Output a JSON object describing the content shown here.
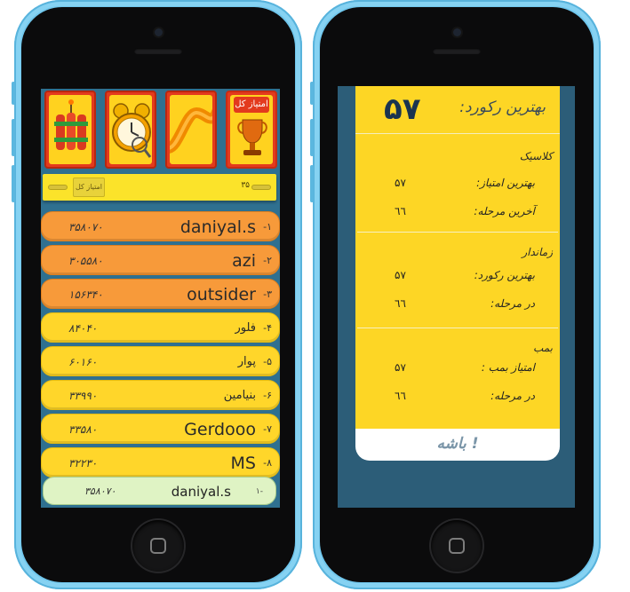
{
  "left": {
    "tiles": {
      "total_score_tile_label": "امتیاز کل"
    },
    "score_bar": {
      "label": "امتیاز کل",
      "value": "۳۵"
    },
    "leaderboard": [
      {
        "rank": "-۱",
        "name": "daniyal.s",
        "points": "۳۵۸۰۷۰",
        "highlight": true
      },
      {
        "rank": "-۲",
        "name": "azi",
        "points": "۳۰۵۵۸۰",
        "highlight": true
      },
      {
        "rank": "-۳",
        "name": "outsider",
        "points": "۱۵۶۳۴۰",
        "highlight": true
      },
      {
        "rank": "-۴",
        "name": "فلور",
        "points": "۸۴۰۴۰",
        "highlight": false
      },
      {
        "rank": "-۵",
        "name": "پوار",
        "points": "۶۰۱۶۰",
        "highlight": false
      },
      {
        "rank": "-۶",
        "name": "بنیامین",
        "points": "۳۳۹۹۰",
        "highlight": false
      },
      {
        "rank": "-۷",
        "name": "Gerdooo",
        "points": "۳۳۵۸۰",
        "highlight": false
      },
      {
        "rank": "-۸",
        "name": "MS",
        "points": "۳۲۲۳۰",
        "highlight": false
      }
    ],
    "my_entry": {
      "rank": "۱-",
      "name": "daniyal.s",
      "points": "۳۵۸۰۷۰"
    }
  },
  "right": {
    "best_record_label": "بهترین رکورد:",
    "best_record_value": "۵۷",
    "sections": [
      {
        "title": "کلاسیک",
        "rows": [
          {
            "key": "بهترین امتیاز:",
            "value": "۵۷"
          },
          {
            "key": "آخرین مرحله:",
            "value": "٦٦"
          }
        ]
      },
      {
        "title": "زماندار",
        "rows": [
          {
            "key": "بهترین رکورد:",
            "value": "۵۷"
          },
          {
            "key": "در مرحله:",
            "value": "٦٦"
          }
        ]
      },
      {
        "title": "بمب",
        "rows": [
          {
            "key": "امتیاز بمب :",
            "value": "۵۷"
          },
          {
            "key": "در مرحله:",
            "value": "٦٦"
          }
        ]
      }
    ],
    "ok_button": "باشه !"
  },
  "colors": {
    "phone_shell": "#6fc6ec",
    "screen_bg": "#2f7090",
    "orange_row": "#f79a3a",
    "yellow_row": "#ffd62a",
    "card_yellow": "#fdd625",
    "my_row": "#dff3c4"
  }
}
